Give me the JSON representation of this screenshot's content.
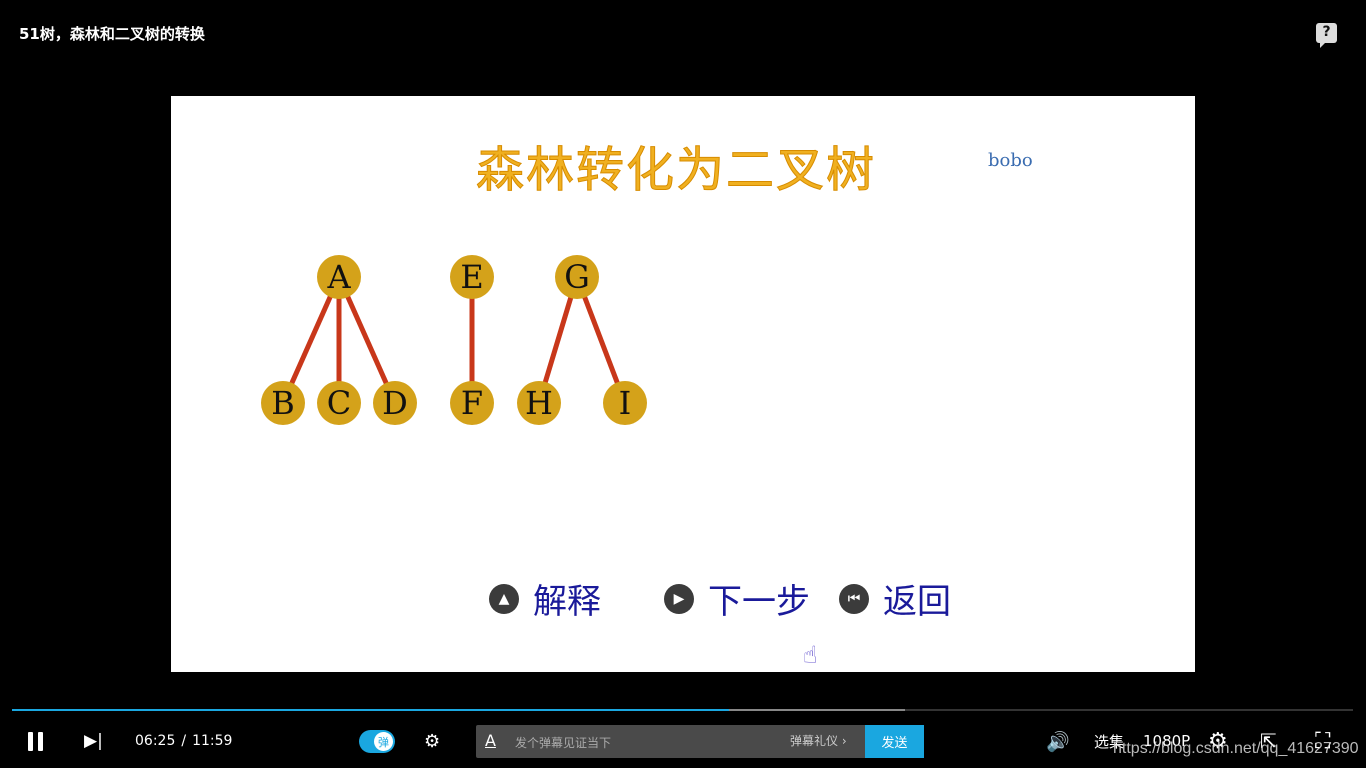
{
  "video": {
    "title": "51树，森林和二叉树的转换"
  },
  "help": {
    "label": "?"
  },
  "slide": {
    "title": "森林转化为二叉树",
    "author": "bobo",
    "trees": [
      {
        "root": "A",
        "children": [
          "B",
          "C",
          "D"
        ]
      },
      {
        "root": "E",
        "children": [
          "F"
        ]
      },
      {
        "root": "G",
        "children": [
          "H",
          "I"
        ]
      }
    ],
    "nav": [
      {
        "icon": "up-arrow-icon",
        "label": "解释"
      },
      {
        "icon": "play-icon",
        "label": "下一步"
      },
      {
        "icon": "back-icon",
        "label": "返回"
      }
    ]
  },
  "player": {
    "current_time": "06:25",
    "separator": "/",
    "duration": "11:59",
    "progress_fraction": 0.535,
    "danmaku_toggle_label": "弹",
    "danmaku_placeholder": "发个弹幕见证当下",
    "danmaku_etiquette": "弹幕礼仪 ›",
    "send_label": "发送",
    "episodes_label": "选集",
    "quality_label": "1080P"
  },
  "watermark": "https://blog.csdn.net/qq_41627390"
}
